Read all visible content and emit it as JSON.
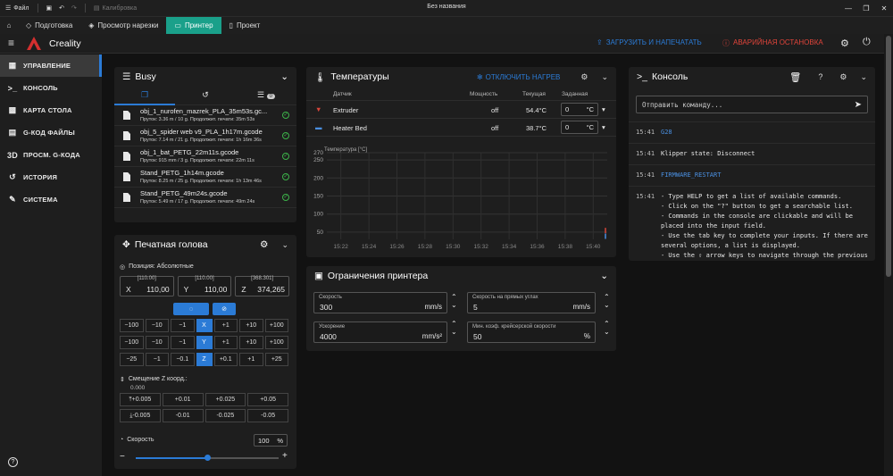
{
  "titlebar": {
    "file": "Файл",
    "calibration": "Калибровка",
    "window_title": "Без названия"
  },
  "tabs": [
    {
      "label": "Подготовка"
    },
    {
      "label": "Просмотр нарезки"
    },
    {
      "label": "Принтер"
    },
    {
      "label": "Проект"
    }
  ],
  "appbar": {
    "brand": "Creality",
    "upload_print": "ЗАГРУЗИТЬ И НАПЕЧАТАТЬ",
    "emergency_stop": "АВАРИЙНАЯ ОСТАНОВКА"
  },
  "sidebar": {
    "items": [
      {
        "label": "УПРАВЛЕНИЕ"
      },
      {
        "label": "КОНСОЛЬ"
      },
      {
        "label": "КАРТА СТОЛА"
      },
      {
        "label": "G-КОД ФАЙЛЫ"
      },
      {
        "label": "ПРОСМ. G-КОДА"
      },
      {
        "label": "ИСТОРИЯ"
      },
      {
        "label": "СИСТЕМА"
      }
    ]
  },
  "busy": {
    "title": "Busy",
    "queue_count": "0",
    "files": [
      {
        "name": "obj_1_nurofen_mazrek_PLA_35m53s.gc...",
        "meta": "Пруток: 3.36 m / 10 g. Продолжит. печати: 35m 53s"
      },
      {
        "name": "obj_5_spider web v9_PLA_1h17m.gcode",
        "meta": "Пруток: 7.14 m / 21 g. Продолжит. печати: 1h 16m 36s"
      },
      {
        "name": "obj_1_bat_PETG_22m11s.gcode",
        "meta": "Пруток: 915 mm / 3 g. Продолжит. печати: 22m 11s"
      },
      {
        "name": "Stand_PETG_1h14m.gcode",
        "meta": "Пруток: 8.25 m / 25 g. Продолжит. печати: 1h 13m 46s"
      },
      {
        "name": "Stand_PETG_49m24s.gcode",
        "meta": "Пруток: 5.49 m / 17 g. Продолжит. печати: 49m 24s"
      }
    ]
  },
  "toolhead": {
    "title": "Печатная голова",
    "position_label": "Позиция: Абсолютные",
    "axes": [
      {
        "axis": "X",
        "value": "110,00",
        "max": "[110.00]"
      },
      {
        "axis": "Y",
        "value": "110,00",
        "max": "[110.00]"
      },
      {
        "axis": "Z",
        "value": "374,265",
        "max": "[368.301]"
      }
    ],
    "jog_rows": [
      [
        "−100",
        "−10",
        "−1",
        "X",
        "+1",
        "+10",
        "+100"
      ],
      [
        "−100",
        "−10",
        "−1",
        "Y",
        "+1",
        "+10",
        "+100"
      ],
      [
        "−25",
        "−1",
        "−0.1",
        "Z",
        "+0.1",
        "+1",
        "+25"
      ]
    ],
    "zoffset_label": "Смещение Z коорд.:",
    "zoffset_value": "0.000",
    "zoffset_up": [
      "+0.005",
      "+0.01",
      "+0.025",
      "+0.05"
    ],
    "zoffset_down": [
      "-0.005",
      "-0.01",
      "-0.025",
      "-0.05"
    ],
    "speed_label": "Скорость",
    "speed_value": "100",
    "speed_unit": "%",
    "speed_fraction": 0.5
  },
  "temps": {
    "title": "Температуры",
    "heaters_off": "ОТКЛЮЧИТЬ НАГРЕВ",
    "headers": {
      "sensor": "Датчик",
      "power": "Мощность",
      "current": "Текущая",
      "target": "Заданная"
    },
    "rows": [
      {
        "name": "Extruder",
        "power": "off",
        "current": "54.4°C",
        "target": "0",
        "unit": "°C"
      },
      {
        "name": "Heater Bed",
        "power": "off",
        "current": "38.7°C",
        "target": "0",
        "unit": "°C"
      }
    ],
    "chart_label": "Температура [°C]"
  },
  "chart_data": {
    "type": "line",
    "ylabel": "Температура [°C]",
    "x": [
      "15:22",
      "15:24",
      "15:26",
      "15:28",
      "15:30",
      "15:32",
      "15:34",
      "15:36",
      "15:38",
      "15:40"
    ],
    "yticks": [
      50,
      100,
      150,
      200,
      250,
      270
    ],
    "ylim": [
      30,
      270
    ],
    "series": [
      {
        "name": "Extruder",
        "color": "#d9463b",
        "values": [
          null,
          null,
          null,
          null,
          null,
          null,
          null,
          null,
          null,
          54.4
        ]
      },
      {
        "name": "Heater Bed",
        "color": "#4a8fe0",
        "values": [
          null,
          null,
          null,
          null,
          null,
          null,
          null,
          null,
          null,
          38.7
        ]
      }
    ]
  },
  "limits": {
    "title": "Ограничения принтера",
    "fields": [
      {
        "label": "Скорость",
        "value": "300",
        "unit": "mm/s"
      },
      {
        "label": "Скорость на прямых углах",
        "value": "5",
        "unit": "mm/s"
      },
      {
        "label": "Ускорение",
        "value": "4000",
        "unit": "mm/s²"
      },
      {
        "label": "Мин. коэф. крейсерской скорости",
        "value": "50",
        "unit": "%"
      }
    ]
  },
  "console": {
    "title": "Консоль",
    "placeholder": "Отправить команду...",
    "lines": [
      {
        "time": "15:41",
        "text": "G28",
        "cmd": true
      },
      {
        "time": "15:41",
        "text": "Klipper state: Disconnect",
        "cmd": false
      },
      {
        "time": "15:41",
        "text": "FIRMWARE_RESTART",
        "cmd": true
      }
    ],
    "help_time": "15:41",
    "help_lines": [
      "- Type HELP to get a list of available commands.",
      "- Click on the \"?\" button to get a searchable list.",
      "- Commands in the console are clickable and will be placed into the input field.",
      "- Use the tab key to complete your inputs. If there are several options, a list is displayed.",
      "- Use the ⇧ arrow keys to navigate through the previous entries."
    ]
  },
  "colors": {
    "accent": "#1aa08a",
    "blue": "#2b7bd6",
    "red": "#e0443a",
    "ok": "#3db34a"
  }
}
